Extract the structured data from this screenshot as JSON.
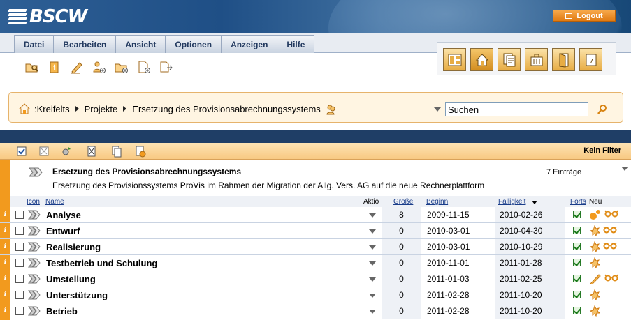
{
  "app": {
    "logo": "BSCW",
    "logout_label": "Logout"
  },
  "menu": [
    "Datei",
    "Bearbeiten",
    "Ansicht",
    "Optionen",
    "Anzeigen",
    "Hilfe"
  ],
  "toolbar_icons": [
    "open-folder-icon",
    "info-icon",
    "edit-pencil-icon",
    "add-member-icon",
    "new-folder-icon",
    "new-document-icon",
    "export-icon"
  ],
  "view_tabs": [
    "layout-icon",
    "home-icon",
    "clipboard-icon",
    "briefcase-icon",
    "door-icon",
    "calendar-icon"
  ],
  "breadcrumb": {
    "root": ":Kreifelts",
    "items": [
      "Projekte",
      "Ersetzung des Provisionsabrechnungssystems"
    ]
  },
  "search": {
    "value": "Suchen"
  },
  "list_toolbar": {
    "filter_label": "Kein Filter"
  },
  "folder": {
    "title": "Ersetzung des Provisionsabrechnungssystems",
    "description": "Ersetzung des Provisionssystems ProVis im Rahmen der Migration der Allg. Vers. AG auf die neue Rechnerplattform",
    "count": "7 Einträge"
  },
  "columns": {
    "icon": "Icon",
    "name": "Name",
    "action": "Aktio",
    "size": "Größe",
    "start": "Beginn",
    "due": "Fälligkeit",
    "progress": "Forts",
    "new": "Neu"
  },
  "rows": [
    {
      "name": "Analyse",
      "size": "8",
      "start": "2009-11-15",
      "due": "2010-02-26",
      "neu": [
        "events-icon",
        "read-glasses-icon"
      ]
    },
    {
      "name": "Entwurf",
      "size": "0",
      "start": "2010-03-01",
      "due": "2010-04-30",
      "neu": [
        "new-star-icon",
        "read-glasses-icon"
      ]
    },
    {
      "name": "Realisierung",
      "size": "0",
      "start": "2010-03-01",
      "due": "2010-10-29",
      "neu": [
        "new-star-icon",
        "read-glasses-icon"
      ]
    },
    {
      "name": "Testbetrieb und Schulung",
      "size": "0",
      "start": "2010-11-01",
      "due": "2011-01-28",
      "neu": [
        "new-star-icon"
      ]
    },
    {
      "name": "Umstellung",
      "size": "0",
      "start": "2011-01-03",
      "due": "2011-02-25",
      "neu": [
        "edit-pencil-icon",
        "read-glasses-icon"
      ]
    },
    {
      "name": "Unterstützung",
      "size": "0",
      "start": "2011-02-28",
      "due": "2011-10-20",
      "neu": [
        "new-star-icon"
      ]
    },
    {
      "name": "Betrieb",
      "size": "0",
      "start": "2011-02-28",
      "due": "2011-10-20",
      "neu": [
        "new-star-icon"
      ]
    }
  ],
  "colors": {
    "header_blue": "#1f4f86",
    "accent_orange": "#f29a1e",
    "crumb_bg": "#fff5e2"
  }
}
